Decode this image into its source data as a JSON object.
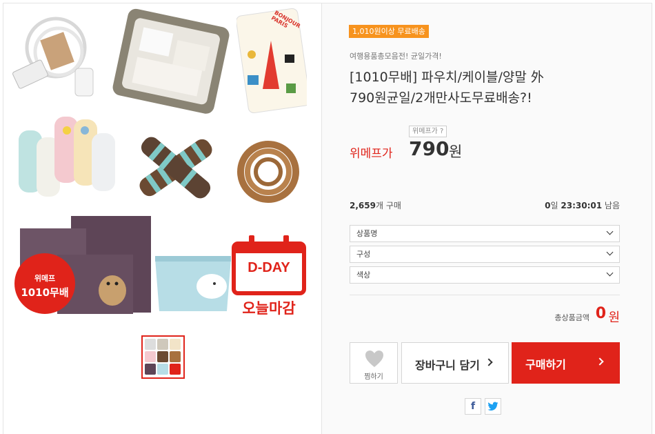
{
  "gallery": {
    "sticker_text": "위메프\n1010무배",
    "sticker_line1": "위메프",
    "sticker_line2": "1010무배",
    "dday_label": "D-DAY",
    "closing_label": "오늘마감",
    "tag_text": "BONJOUR PARIS"
  },
  "product": {
    "badge": "1,010원이상 무료배송",
    "subtitle": "여행용품총모음전! 균일가격!",
    "title_line1": "[1010무배] 파우치/케이블/양말 外",
    "title_line2": "790원균일/2개만사도무료배송?!",
    "price_tag": "위메프가 ?",
    "price_label": "위메프가",
    "price": "790",
    "price_unit": "원",
    "sold_count": "2,659",
    "sold_suffix": "개 구매",
    "remain_days": "0",
    "remain_days_suffix": "일",
    "remain_time": "23:30:01",
    "remain_suffix": "남음"
  },
  "options": [
    {
      "label": "상품명"
    },
    {
      "label": "구성"
    },
    {
      "label": "색상"
    }
  ],
  "total": {
    "label": "총상품금액",
    "value": "0",
    "unit": "원"
  },
  "actions": {
    "like_label": "찜하기",
    "cart_label": "장바구니 담기",
    "buy_label": "구매하기"
  },
  "share": {
    "facebook": "f",
    "twitter": "t"
  },
  "colors": {
    "accent_red": "#e0231a",
    "badge_orange": "#f7931e"
  }
}
